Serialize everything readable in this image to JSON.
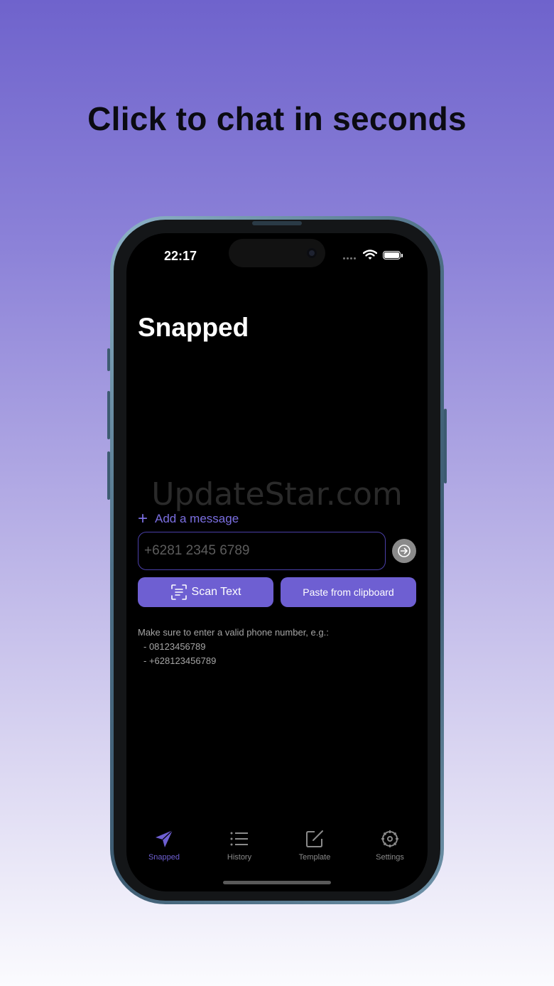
{
  "headline": "Click to chat in seconds",
  "status_bar": {
    "time": "22:17"
  },
  "app": {
    "title": "Snapped",
    "watermark": "UpdateStar.com",
    "add_message_label": "Add a message",
    "phone_placeholder": "+6281 2345 6789",
    "scan_button_label": "Scan Text",
    "paste_button_label": "Paste from clipboard",
    "hint": {
      "intro": "Make sure to enter a valid phone number, e.g.:",
      "examples": [
        "- 08123456789",
        "- +628123456789"
      ]
    }
  },
  "tabs": [
    {
      "label": "Snapped",
      "icon": "send-icon",
      "active": true
    },
    {
      "label": "History",
      "icon": "list-icon",
      "active": false
    },
    {
      "label": "Template",
      "icon": "edit-icon",
      "active": false
    },
    {
      "label": "Settings",
      "icon": "gear-icon",
      "active": false
    }
  ],
  "colors": {
    "accent": "#6E5FD2",
    "background": "#000000",
    "gradient_top": "#6F63CC"
  }
}
